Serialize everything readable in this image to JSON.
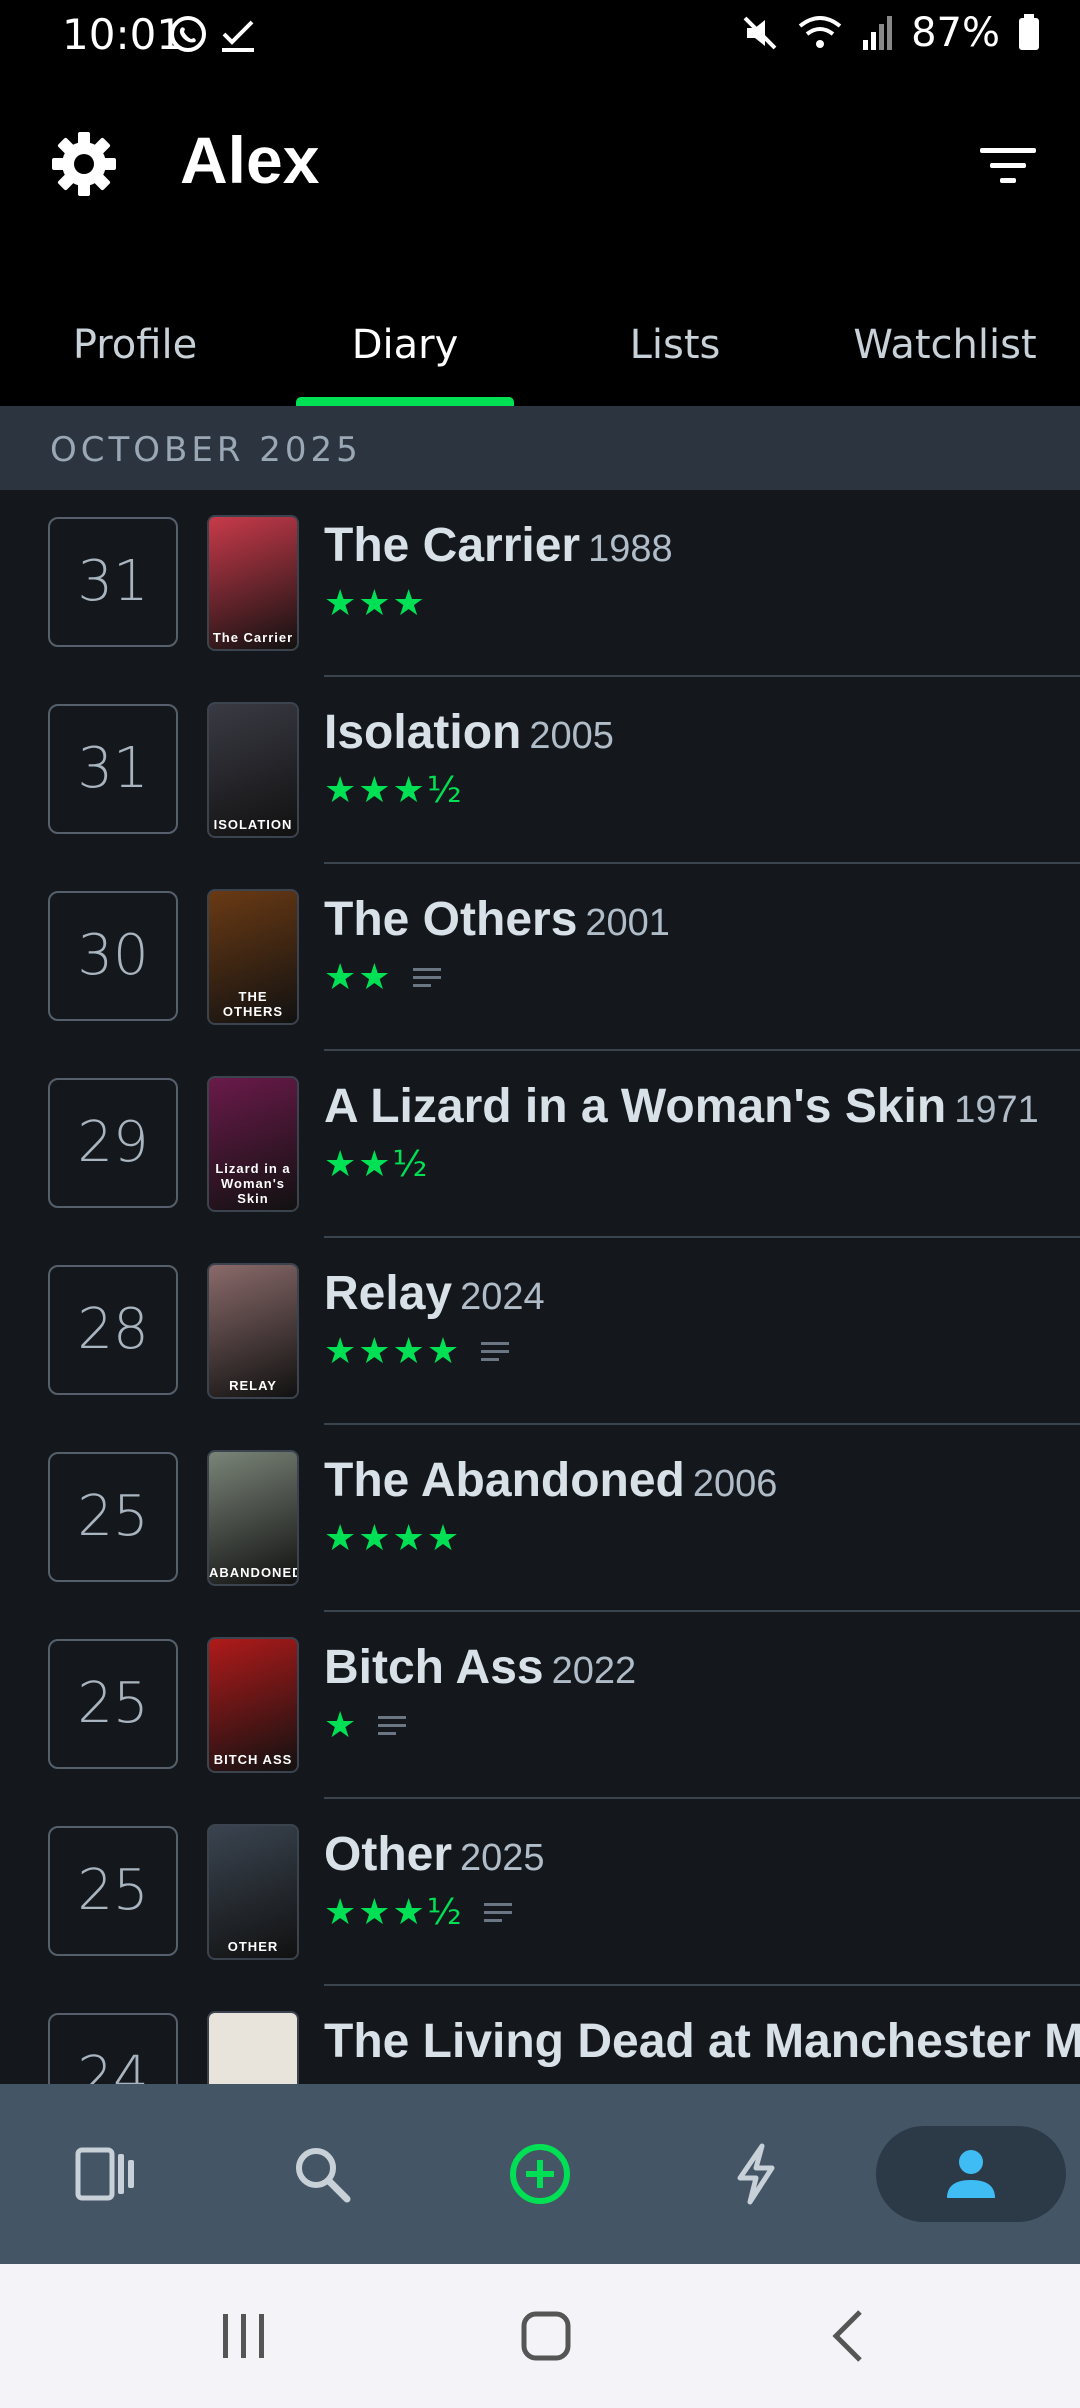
{
  "status_bar": {
    "time": "10:01",
    "battery": "87%"
  },
  "header": {
    "title": "Alex"
  },
  "tabs": [
    {
      "label": "Profile",
      "active": false
    },
    {
      "label": "Diary",
      "active": true
    },
    {
      "label": "Lists",
      "active": false
    },
    {
      "label": "Watchlist",
      "active": false
    }
  ],
  "month_header": "OCTOBER 2025",
  "entries": [
    {
      "day": "31",
      "title": "The Carrier",
      "year": "1988",
      "stars": "★★★",
      "review": false,
      "poster_color": "#c83a4a",
      "poster_text": "The Carrier"
    },
    {
      "day": "31",
      "title": "Isolation",
      "year": "2005",
      "stars": "★★★½",
      "review": false,
      "poster_color": "#3a3a44",
      "poster_text": "ISOLATION"
    },
    {
      "day": "30",
      "title": "The Others",
      "year": "2001",
      "stars": "★★",
      "review": true,
      "poster_color": "#6a3a14",
      "poster_text": "THE OTHERS"
    },
    {
      "day": "29",
      "title": "A Lizard in a Woman's Skin",
      "year": "1971",
      "stars": "★★½",
      "review": false,
      "poster_color": "#6a1a4a",
      "poster_text": "Lizard in a Woman's Skin"
    },
    {
      "day": "28",
      "title": "Relay",
      "year": "2024",
      "stars": "★★★★",
      "review": true,
      "poster_color": "#8a6a6a",
      "poster_text": "RELAY"
    },
    {
      "day": "25",
      "title": "The Abandoned",
      "year": "2006",
      "stars": "★★★★",
      "review": false,
      "poster_color": "#7a8478",
      "poster_text": "ABANDONED"
    },
    {
      "day": "25",
      "title": "Bitch Ass",
      "year": "2022",
      "stars": "★",
      "review": true,
      "poster_color": "#b01a1a",
      "poster_text": "BITCH ASS"
    },
    {
      "day": "25",
      "title": "Other",
      "year": "2025",
      "stars": "★★★½",
      "review": true,
      "poster_color": "#3a4450",
      "poster_text": "OTHER"
    },
    {
      "day": "24",
      "title": "The Living Dead at Manchester Morgue",
      "year": "",
      "stars": "",
      "review": false,
      "poster_color": "#e8e4dc",
      "poster_text": ""
    }
  ],
  "bottom_nav": [
    {
      "icon": "films-icon"
    },
    {
      "icon": "search-icon"
    },
    {
      "icon": "add-circle-icon"
    },
    {
      "icon": "activity-icon"
    },
    {
      "icon": "profile-icon",
      "active": true
    }
  ],
  "colors": {
    "accent": "#00e054",
    "background": "#14181c",
    "active_nav": "#40bcf4"
  }
}
